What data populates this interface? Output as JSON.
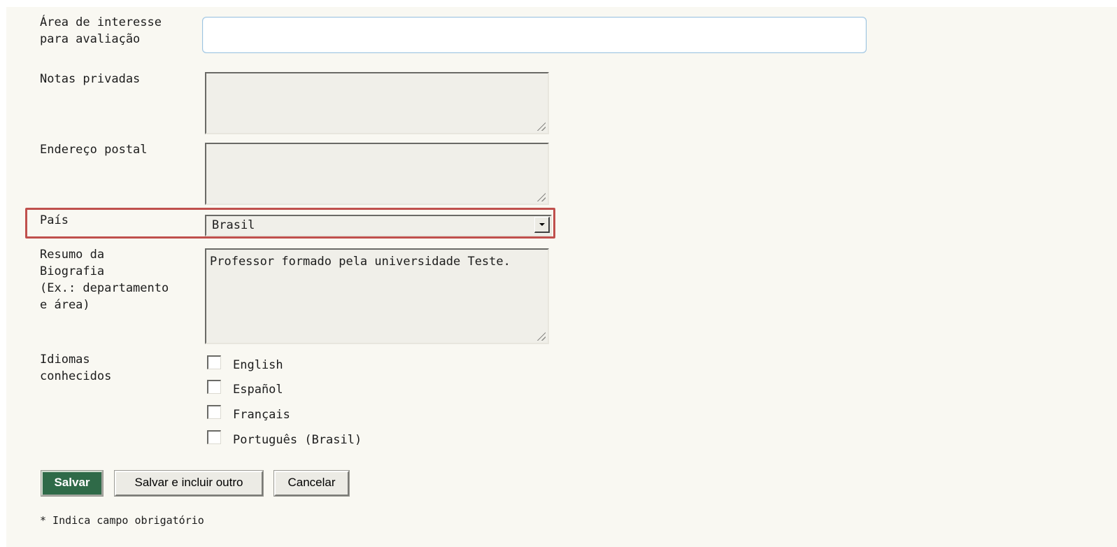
{
  "form": {
    "interest_area": {
      "label": "Área de interesse\npara avaliação",
      "value": ""
    },
    "private_notes": {
      "label": "Notas privadas",
      "value": ""
    },
    "postal_address": {
      "label": "Endereço postal",
      "value": ""
    },
    "country": {
      "label": "País",
      "selected": "Brasil"
    },
    "bio": {
      "label": "Resumo da\nBiografia\n(Ex.: departamento\ne área)",
      "value": "Professor formado pela universidade Teste."
    },
    "languages": {
      "label": "Idiomas\nconhecidos",
      "options": [
        {
          "label": "English",
          "checked": false
        },
        {
          "label": "Español",
          "checked": false
        },
        {
          "label": "Français",
          "checked": false
        },
        {
          "label": "Português (Brasil)",
          "checked": false
        }
      ]
    }
  },
  "buttons": {
    "save": "Salvar",
    "save_and_add": "Salvar e incluir outro",
    "cancel": "Cancelar"
  },
  "footnote": "* Indica campo obrigatório",
  "colors": {
    "page_bg": "#f9f8f2",
    "primary_button": "#2f6a48",
    "highlight_border": "#c0504d",
    "input_focus_border": "#9cc3e0"
  },
  "icons": {
    "select_arrow": "chevron-down-icon",
    "resize_grip": "resize-grip-icon"
  }
}
